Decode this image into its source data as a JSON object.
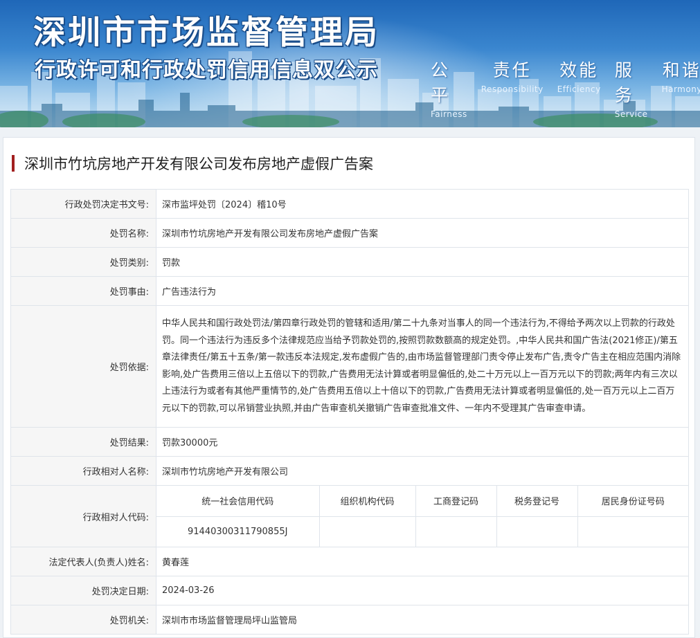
{
  "banner": {
    "title": "深圳市市场监督管理局",
    "subtitle": "行政许可和行政处罚信用信息双公示",
    "slogans": [
      {
        "cn": "公平",
        "en": "Fairness"
      },
      {
        "cn": "责任",
        "en": "Responsibility"
      },
      {
        "cn": "效能",
        "en": "Efficiency"
      },
      {
        "cn": "服务",
        "en": "Service"
      },
      {
        "cn": "和谐",
        "en": "Harmony"
      }
    ]
  },
  "case_title": "深圳市竹坑房地产开发有限公司发布房地产虚假广告案",
  "fields": {
    "doc_no": {
      "label": "行政处罚决定书文号:",
      "value": "深市监坪处罚〔2024〕稽10号"
    },
    "name": {
      "label": "处罚名称:",
      "value": "深圳市竹坑房地产开发有限公司发布房地产虚假广告案"
    },
    "category": {
      "label": "处罚类别:",
      "value": "罚款"
    },
    "reason": {
      "label": "处罚事由:",
      "value": "广告违法行为"
    },
    "basis": {
      "label": "处罚依据:",
      "value": "中华人民共和国行政处罚法/第四章行政处罚的管辖和适用/第二十九条对当事人的同一个违法行为,不得给予两次以上罚款的行政处罚。同一个违法行为违反多个法律规范应当给予罚款处罚的,按照罚款数额高的规定处罚。,中华人民共和国广告法(2021修正)/第五章法律责任/第五十五条/第一款违反本法规定,发布虚假广告的,由市场监督管理部门责令停止发布广告,责令广告主在相应范围内消除影响,处广告费用三倍以上五倍以下的罚款,广告费用无法计算或者明显偏低的,处二十万元以上一百万元以下的罚款;两年内有三次以上违法行为或者有其他严重情节的,处广告费用五倍以上十倍以下的罚款,广告费用无法计算或者明显偏低的,处一百万元以上二百万元以下的罚款,可以吊销营业执照,并由广告审查机关撤销广告审查批准文件、一年内不受理其广告审查申请。"
    },
    "result": {
      "label": "处罚结果:",
      "value": "罚款30000元"
    },
    "party_name": {
      "label": "行政相对人名称:",
      "value": "深圳市竹坑房地产开发有限公司"
    },
    "party_code": {
      "label": "行政相对人代码:",
      "headers": [
        "统一社会信用代码",
        "组织机构代码",
        "工商登记码",
        "税务登记号",
        "居民身份证号码"
      ],
      "values": [
        "91440300311790855J",
        "",
        "",
        "",
        ""
      ]
    },
    "legal_rep": {
      "label": "法定代表人(负责人)姓名:",
      "value": "黄春莲"
    },
    "decision_date": {
      "label": "处罚决定日期:",
      "value": "2024-03-26"
    },
    "authority": {
      "label": "处罚机关:",
      "value": "深圳市市场监督管理局坪山监管局"
    }
  }
}
